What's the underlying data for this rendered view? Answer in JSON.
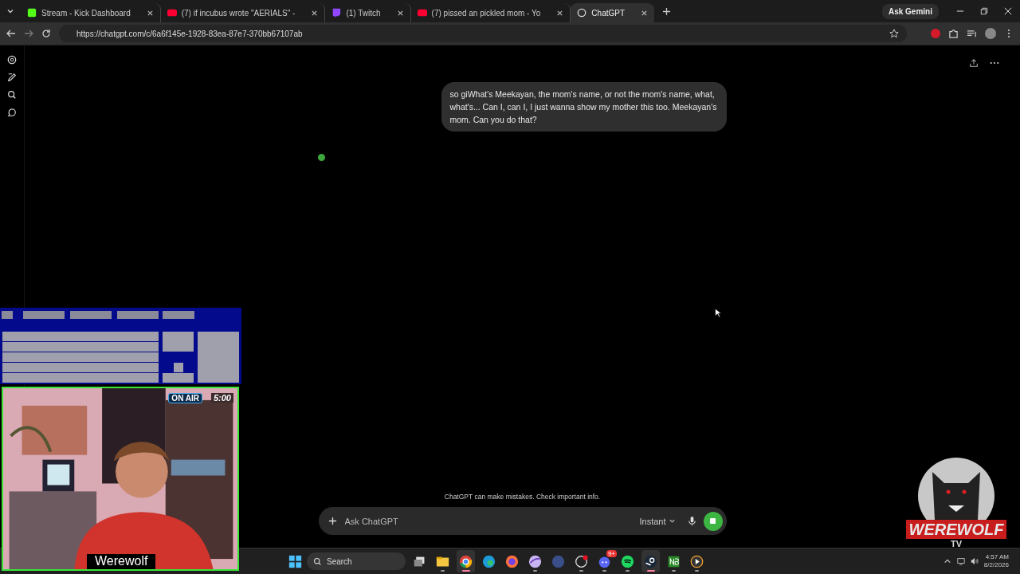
{
  "browser": {
    "tabs": [
      {
        "kind": "kick",
        "title": "Stream - Kick Dashboard",
        "selected": false
      },
      {
        "kind": "youtube",
        "title": "(7) if incubus wrote \"AERIALS\" -",
        "selected": false
      },
      {
        "kind": "twitch",
        "title": "(1) Twitch",
        "selected": false
      },
      {
        "kind": "youtube",
        "title": "(7) pissed an pickled mom - Yo",
        "selected": false
      },
      {
        "kind": "chatgpt",
        "title": "ChatGPT",
        "selected": true
      }
    ],
    "ask_gemini": "Ask Gemini",
    "url": "https://chatgpt.com/c/6a6f145e-1928-83ea-87e7-370bb67107ab"
  },
  "chat": {
    "message": "so giWhat's Meekayan, the mom's name, or not the mom's name, what, what's... Can I, can I, I just wanna show my mother this too. Meekayan's mom. Can you do that?",
    "disclaimer": "ChatGPT can make mistakes. Check important info.",
    "composer": {
      "placeholder": "Ask ChatGPT",
      "mode": "Instant",
      "generating": true
    }
  },
  "overlay": {
    "on_air": "ON AIR",
    "timer": "5:00",
    "name": "Werewolf",
    "logo_title": "WEREWOLF",
    "logo_sub": "TV"
  },
  "taskbar": {
    "search_placeholder": "Search",
    "apps": [
      {
        "kind": "taskview",
        "running": false,
        "active": false
      },
      {
        "kind": "files",
        "running": true,
        "active": false
      },
      {
        "kind": "chrome",
        "running": true,
        "active": true
      },
      {
        "kind": "edge",
        "running": false,
        "active": false
      },
      {
        "kind": "firefox",
        "running": false,
        "active": false
      },
      {
        "kind": "feather",
        "running": true,
        "active": false
      },
      {
        "kind": "orb",
        "running": false,
        "active": false
      },
      {
        "kind": "obs",
        "running": true,
        "active": false
      },
      {
        "kind": "discord",
        "running": true,
        "active": false,
        "badge": "9+"
      },
      {
        "kind": "spotify",
        "running": true,
        "active": false
      },
      {
        "kind": "steam",
        "running": true,
        "active": true
      },
      {
        "kind": "notebook",
        "running": true,
        "active": false
      },
      {
        "kind": "player",
        "running": true,
        "active": false
      }
    ],
    "time": "4:57 AM",
    "date": "8/2/2026"
  }
}
